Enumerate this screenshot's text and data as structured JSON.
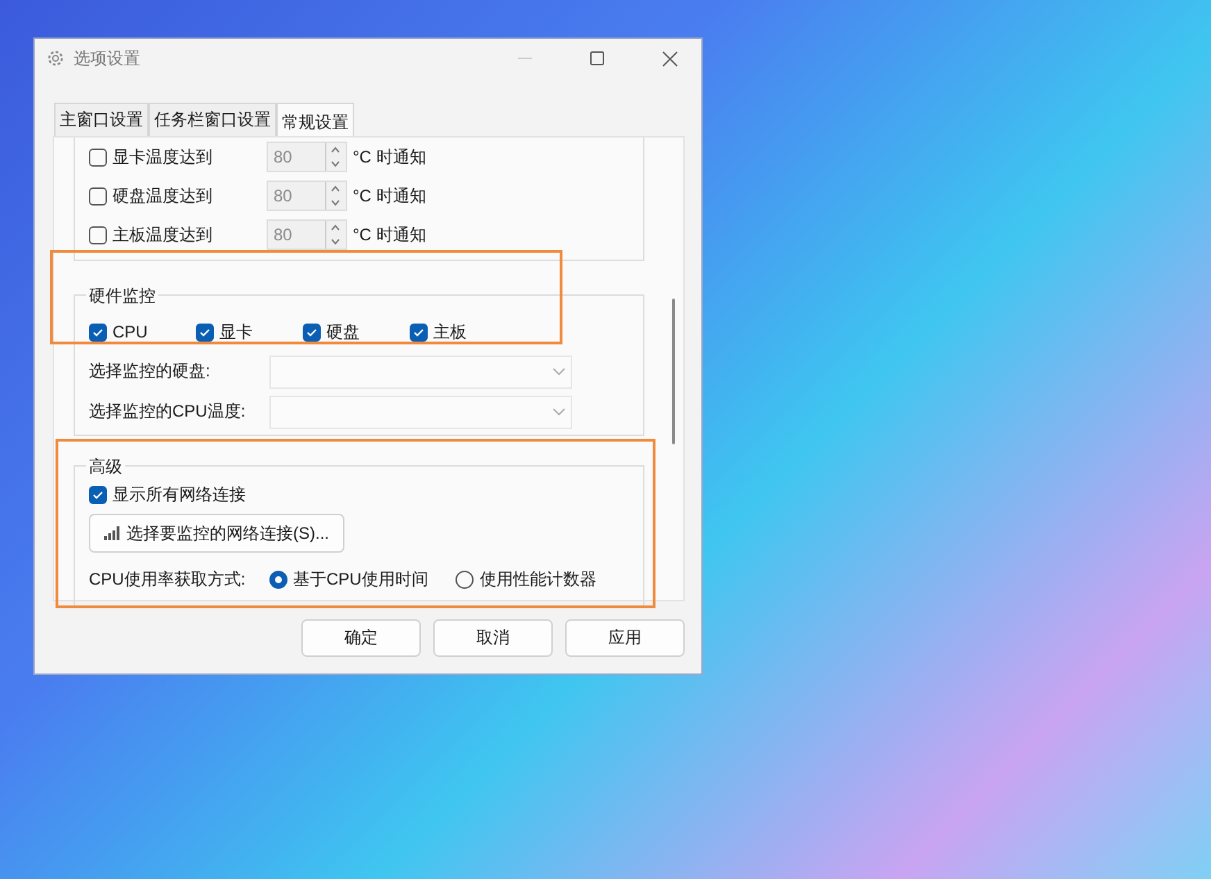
{
  "window": {
    "title": "选项设置"
  },
  "tabs": [
    {
      "label": "主窗口设置",
      "selected": false
    },
    {
      "label": "任务栏窗口设置",
      "selected": false
    },
    {
      "label": "常规设置",
      "selected": true
    }
  ],
  "temperature_alerts": [
    {
      "label": "显卡温度达到",
      "checked": false,
      "value": "80",
      "disabled": true,
      "unit": "°C 时通知"
    },
    {
      "label": "硬盘温度达到",
      "checked": false,
      "value": "80",
      "disabled": true,
      "unit": "°C 时通知"
    },
    {
      "label": "主板温度达到",
      "checked": false,
      "value": "80",
      "disabled": true,
      "unit": "°C 时通知"
    }
  ],
  "hardware_monitor": {
    "title": "硬件监控",
    "items": [
      {
        "label": "CPU",
        "checked": true
      },
      {
        "label": "显卡",
        "checked": true
      },
      {
        "label": "硬盘",
        "checked": true
      },
      {
        "label": "主板",
        "checked": true
      }
    ],
    "fields": [
      {
        "label": "选择监控的硬盘:"
      },
      {
        "label": "选择监控的CPU温度:"
      }
    ]
  },
  "advanced": {
    "title": "高级",
    "show_all": {
      "label": "显示所有网络连接",
      "checked": true
    },
    "select_button": {
      "label": "选择要监控的网络连接(S)..."
    },
    "cpu_method": {
      "label": "CPU使用率获取方式:",
      "options": [
        {
          "label": "基于CPU使用时间",
          "selected": true
        },
        {
          "label": "使用性能计数器",
          "selected": false
        }
      ]
    }
  },
  "buttons": [
    {
      "label": "确定"
    },
    {
      "label": "取消"
    },
    {
      "label": "应用"
    }
  ]
}
